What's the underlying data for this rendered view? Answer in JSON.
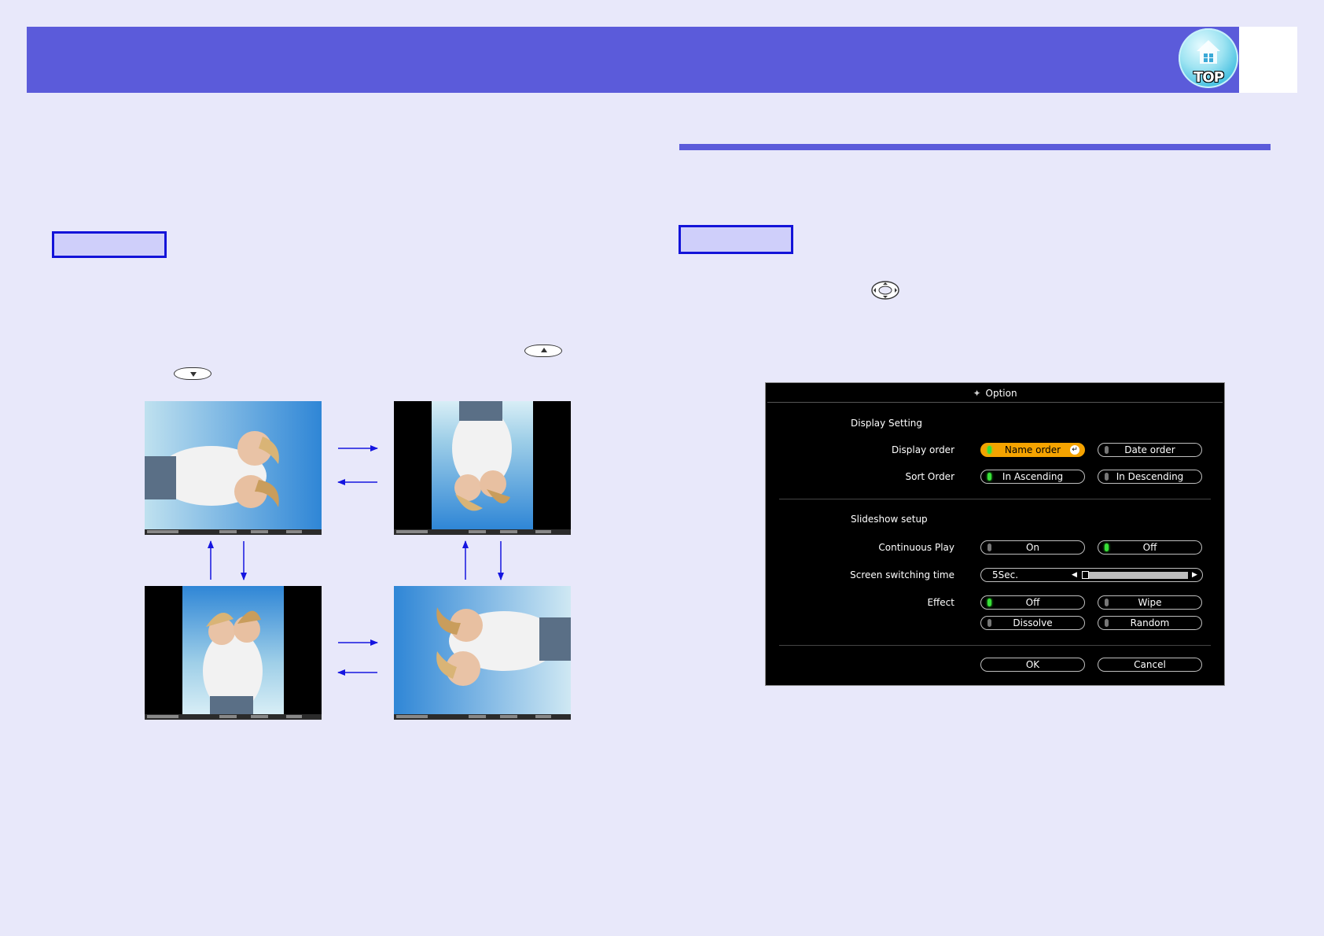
{
  "header": {
    "top_icon_label": "TOP"
  },
  "thumbnails": {
    "status_bar": [
      "Previous Slide",
      "Rotate",
      "Slideshow",
      "Return"
    ]
  },
  "dialog": {
    "title": "Option",
    "display_setting": {
      "heading": "Display Setting",
      "display_order_label": "Display order",
      "name_order": "Name order",
      "date_order": "Date order",
      "sort_order_label": "Sort Order",
      "ascending": "In Ascending",
      "descending": "In Descending"
    },
    "slideshow_setup": {
      "heading": "Slideshow setup",
      "continuous_play_label": "Continuous Play",
      "on": "On",
      "off": "Off",
      "switching_time_label": "Screen switching time",
      "switching_time_value": "5Sec.",
      "switching_time_level": 0,
      "effect_label": "Effect",
      "effect_off": "Off",
      "effect_wipe": "Wipe",
      "effect_dissolve": "Dissolve",
      "effect_random": "Random"
    },
    "ok": "OK",
    "cancel": "Cancel"
  },
  "colors": {
    "page_bg": "#e8e8fa",
    "header": "#5b5bda",
    "label_box_border": "#1313d9",
    "label_box_fill": "#cfcffa",
    "arrow": "#1515e0",
    "active_option": "#f5a300",
    "led_on": "#38e038"
  }
}
